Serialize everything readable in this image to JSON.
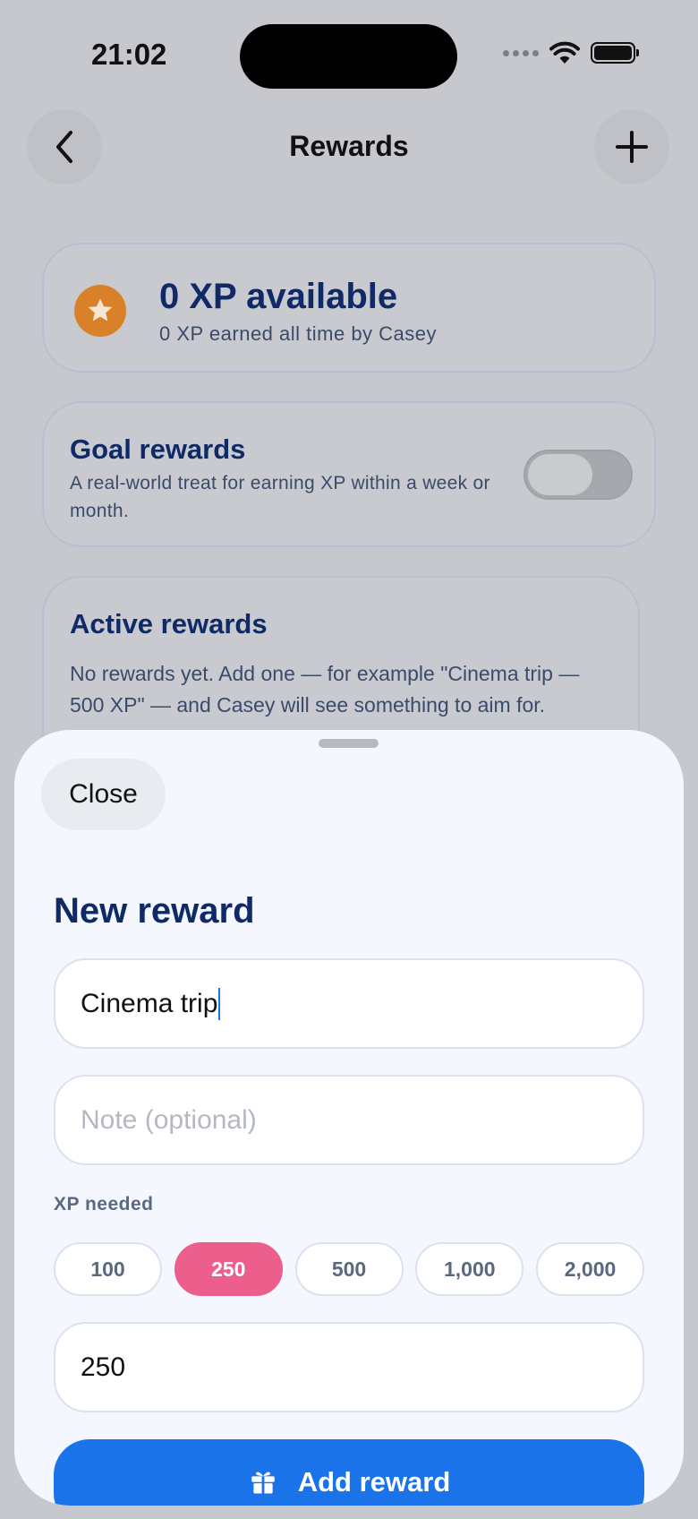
{
  "status": {
    "time": "21:02"
  },
  "nav": {
    "title": "Rewards"
  },
  "xp_card": {
    "title": "0 XP available",
    "subtitle": "0 XP earned all time by Casey"
  },
  "goal_rewards": {
    "title": "Goal rewards",
    "description": "A real-world treat for earning XP within a week or month.",
    "enabled": false
  },
  "active_rewards": {
    "title": "Active rewards",
    "empty_text": "No rewards yet. Add one — for example \"Cinema trip — 500 XP\" — and Casey will see something to aim for."
  },
  "sheet": {
    "close_label": "Close",
    "title": "New reward",
    "name_value": "Cinema trip",
    "note_placeholder": "Note (optional)",
    "xp_label": "XP needed",
    "chips": [
      "100",
      "250",
      "500",
      "1,000",
      "2,000"
    ],
    "selected_chip": "250",
    "xp_value": "250",
    "submit_label": "Add reward"
  },
  "colors": {
    "accent_blue": "#1a73e8",
    "chip_selected": "#ec5f8d",
    "star_orange": "#d98128",
    "heading_navy": "#0f2a66"
  },
  "icons": {
    "back": "chevron-left-icon",
    "add": "plus-icon",
    "xp": "star-icon",
    "submit": "gift-icon"
  }
}
